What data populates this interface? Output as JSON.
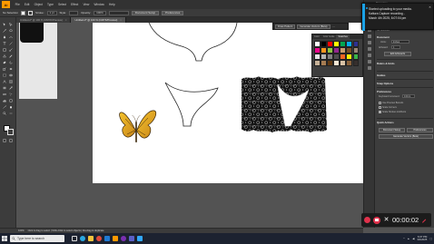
{
  "menubar": {
    "logo": "Ai",
    "items": [
      "File",
      "Edit",
      "Object",
      "Type",
      "Select",
      "Effect",
      "View",
      "Window",
      "Help"
    ]
  },
  "control_bar": {
    "selection_label": "No Selection",
    "stroke_label": "Stroke:",
    "stroke_value": "1 pt",
    "style_label": "Style:",
    "opacity_label": "Opacity:",
    "opacity_value": "100%",
    "document_setup": "Document Setup",
    "preferences": "Preferences"
  },
  "tabs": [
    {
      "label": "Untitled-2* @ 100 % (CMYK/Preview)",
      "active": false
    },
    {
      "label": "Untitled-3* @ 100 % (CMYK/Preview)",
      "active": true
    }
  ],
  "context_bar": {
    "draw_button": "Draw Pattern",
    "generate_button": "Generate Vectors (Beta)"
  },
  "swatches_panel": {
    "tabs": [
      "Color",
      "Color Guide",
      "Swatches"
    ],
    "colors": [
      "#ffffff",
      "#000000",
      "#ff0000",
      "#ffff00",
      "#00a651",
      "#00aeef",
      "#2e3192",
      "#ec008c",
      "#f7941d",
      "#8dc63f",
      "#92278f",
      "#c69c6d",
      "#754c24",
      "#998675",
      "#e6e6e6",
      "#b3b3b3",
      "#808080",
      "#4d4d4d",
      "#f26522",
      "#fff200",
      "#39b54a",
      "#c7b299",
      "#a67c52",
      "#603913",
      "#f5e6d3",
      "#d9c2a6",
      "#8c6239",
      "#362f2d"
    ]
  },
  "properties_panel": {
    "title": "Properties",
    "doc_label": "No Selection",
    "document_section": "Document",
    "units_label": "Units:",
    "units_value": "Inches",
    "artboard_label": "Artboard:",
    "artboard_value": "1",
    "edit_artboards": "Edit Artboards",
    "rulers_section": "Rulers & Grids",
    "guides_section": "Guides",
    "snap_section": "Snap Options",
    "preferences_section": "Preferences",
    "keyboard_increment_label": "Keyboard Increment:",
    "keyboard_increment_value": "0.01 in",
    "use_preview_bounds": "Use Preview Bounds",
    "scale_corners": "Scale Corners",
    "scale_strokes": "Scale Strokes & Effects",
    "quick_actions": "Quick Actions",
    "document_setup_button": "Document Setup",
    "preferences_button": "Preferences",
    "generate_vectors_button": "Generate Vectors (Beta)"
  },
  "notification": {
    "line1": "Started uploading to your media.",
    "line2": "Kaltura Capture recording -",
    "line3": "March 4th 2025, 6:07:04 pm",
    "close": "✕"
  },
  "recording": {
    "time": "00:00:02"
  },
  "statusbar": {
    "zoom": "100%",
    "hint": "Click & drag to select | Shift+Click to select objects | Alt+drag to duplicate"
  },
  "taskbar": {
    "search_placeholder": "Type here to search",
    "time": "6:07 PM",
    "date": "3/4/2025"
  },
  "colors": {
    "accent": "#1aa1e6",
    "record": "#e0314b",
    "ai_orange": "#ff9a00"
  }
}
